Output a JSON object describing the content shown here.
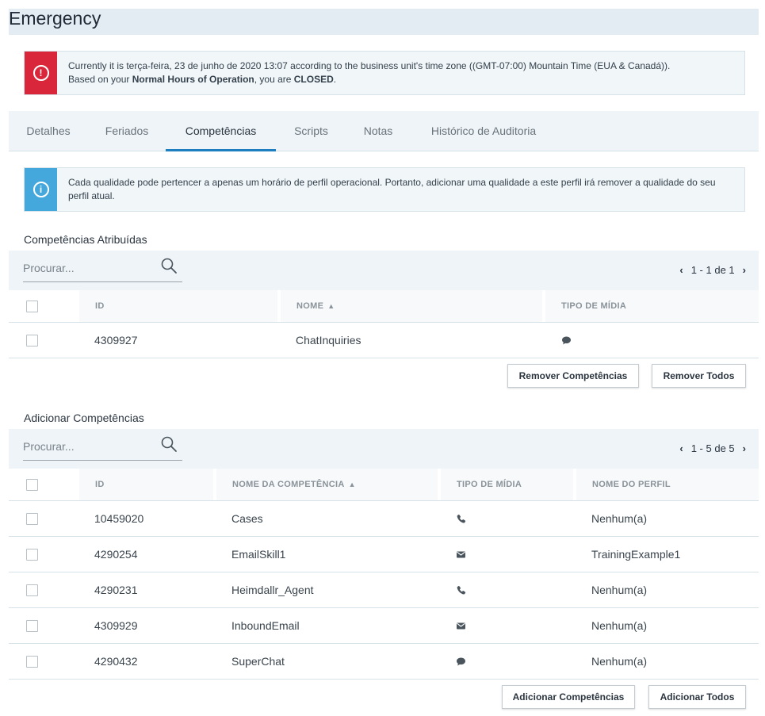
{
  "page": {
    "title": "Emergency"
  },
  "status_alert": {
    "line1": "Currently it is terça-feira, 23 de junho de 2020 13:07 according to the business unit's time zone ((GMT-07:00) Mountain Time (EUA & Canadá)).",
    "line2_prefix": "Based on your ",
    "line2_bold": "Normal Hours of Operation",
    "line2_mid": ", you are ",
    "line2_status": "CLOSED",
    "line2_suffix": ".",
    "icon_glyph": "!",
    "color": "#d9263b"
  },
  "tabs": [
    {
      "label": "Detalhes",
      "active": false
    },
    {
      "label": "Feriados",
      "active": false
    },
    {
      "label": "Competências",
      "active": true
    },
    {
      "label": "Scripts",
      "active": false
    },
    {
      "label": "Notas",
      "active": false
    },
    {
      "label": "Histórico de Auditoria",
      "active": false
    }
  ],
  "info_alert": {
    "text": "Cada qualidade pode pertencer a apenas um horário de perfil operacional. Portanto, adicionar uma qualidade a este perfil irá remover a qualidade do seu perfil atual.",
    "icon_glyph": "i",
    "color": "#44a8dc"
  },
  "assigned": {
    "title": "Competências Atribuídas",
    "search_placeholder": "Procurar...",
    "pager_text": "1 - 1 de 1",
    "pager_prev": "‹",
    "pager_next": "›",
    "columns": {
      "id": "ID",
      "name": "NOME",
      "media": "TIPO DE MÍDIA"
    },
    "sort_glyph": "▲",
    "rows": [
      {
        "id": "4309927",
        "name": "ChatInquiries",
        "media": "chat-icon"
      }
    ],
    "remove_button": "Remover Competências",
    "remove_all_button": "Remover Todos"
  },
  "add": {
    "title": "Adicionar Competências",
    "search_placeholder": "Procurar...",
    "pager_text": "1 - 5 de 5",
    "pager_prev": "‹",
    "pager_next": "›",
    "columns": {
      "id": "ID",
      "name": "NOME DA COMPETÊNCIA",
      "media": "TIPO DE MÍDIA",
      "profile": "NOME DO PERFIL"
    },
    "sort_glyph": "▲",
    "rows": [
      {
        "id": "10459020",
        "name": "Cases",
        "media": "phone-icon",
        "profile": "Nenhum(a)"
      },
      {
        "id": "4290254",
        "name": "EmailSkill1",
        "media": "email-icon",
        "profile": "TrainingExample1"
      },
      {
        "id": "4290231",
        "name": "Heimdallr_Agent",
        "media": "phone-icon",
        "profile": "Nenhum(a)"
      },
      {
        "id": "4309929",
        "name": "InboundEmail",
        "media": "email-icon",
        "profile": "Nenhum(a)"
      },
      {
        "id": "4290432",
        "name": "SuperChat",
        "media": "chat-icon",
        "profile": "Nenhum(a)"
      }
    ],
    "add_button": "Adicionar Competências",
    "add_all_button": "Adicionar Todos"
  },
  "colors": {
    "accent": "#1e7fc0",
    "panel": "#eef4f7",
    "title_bg": "#e3ebf3"
  }
}
